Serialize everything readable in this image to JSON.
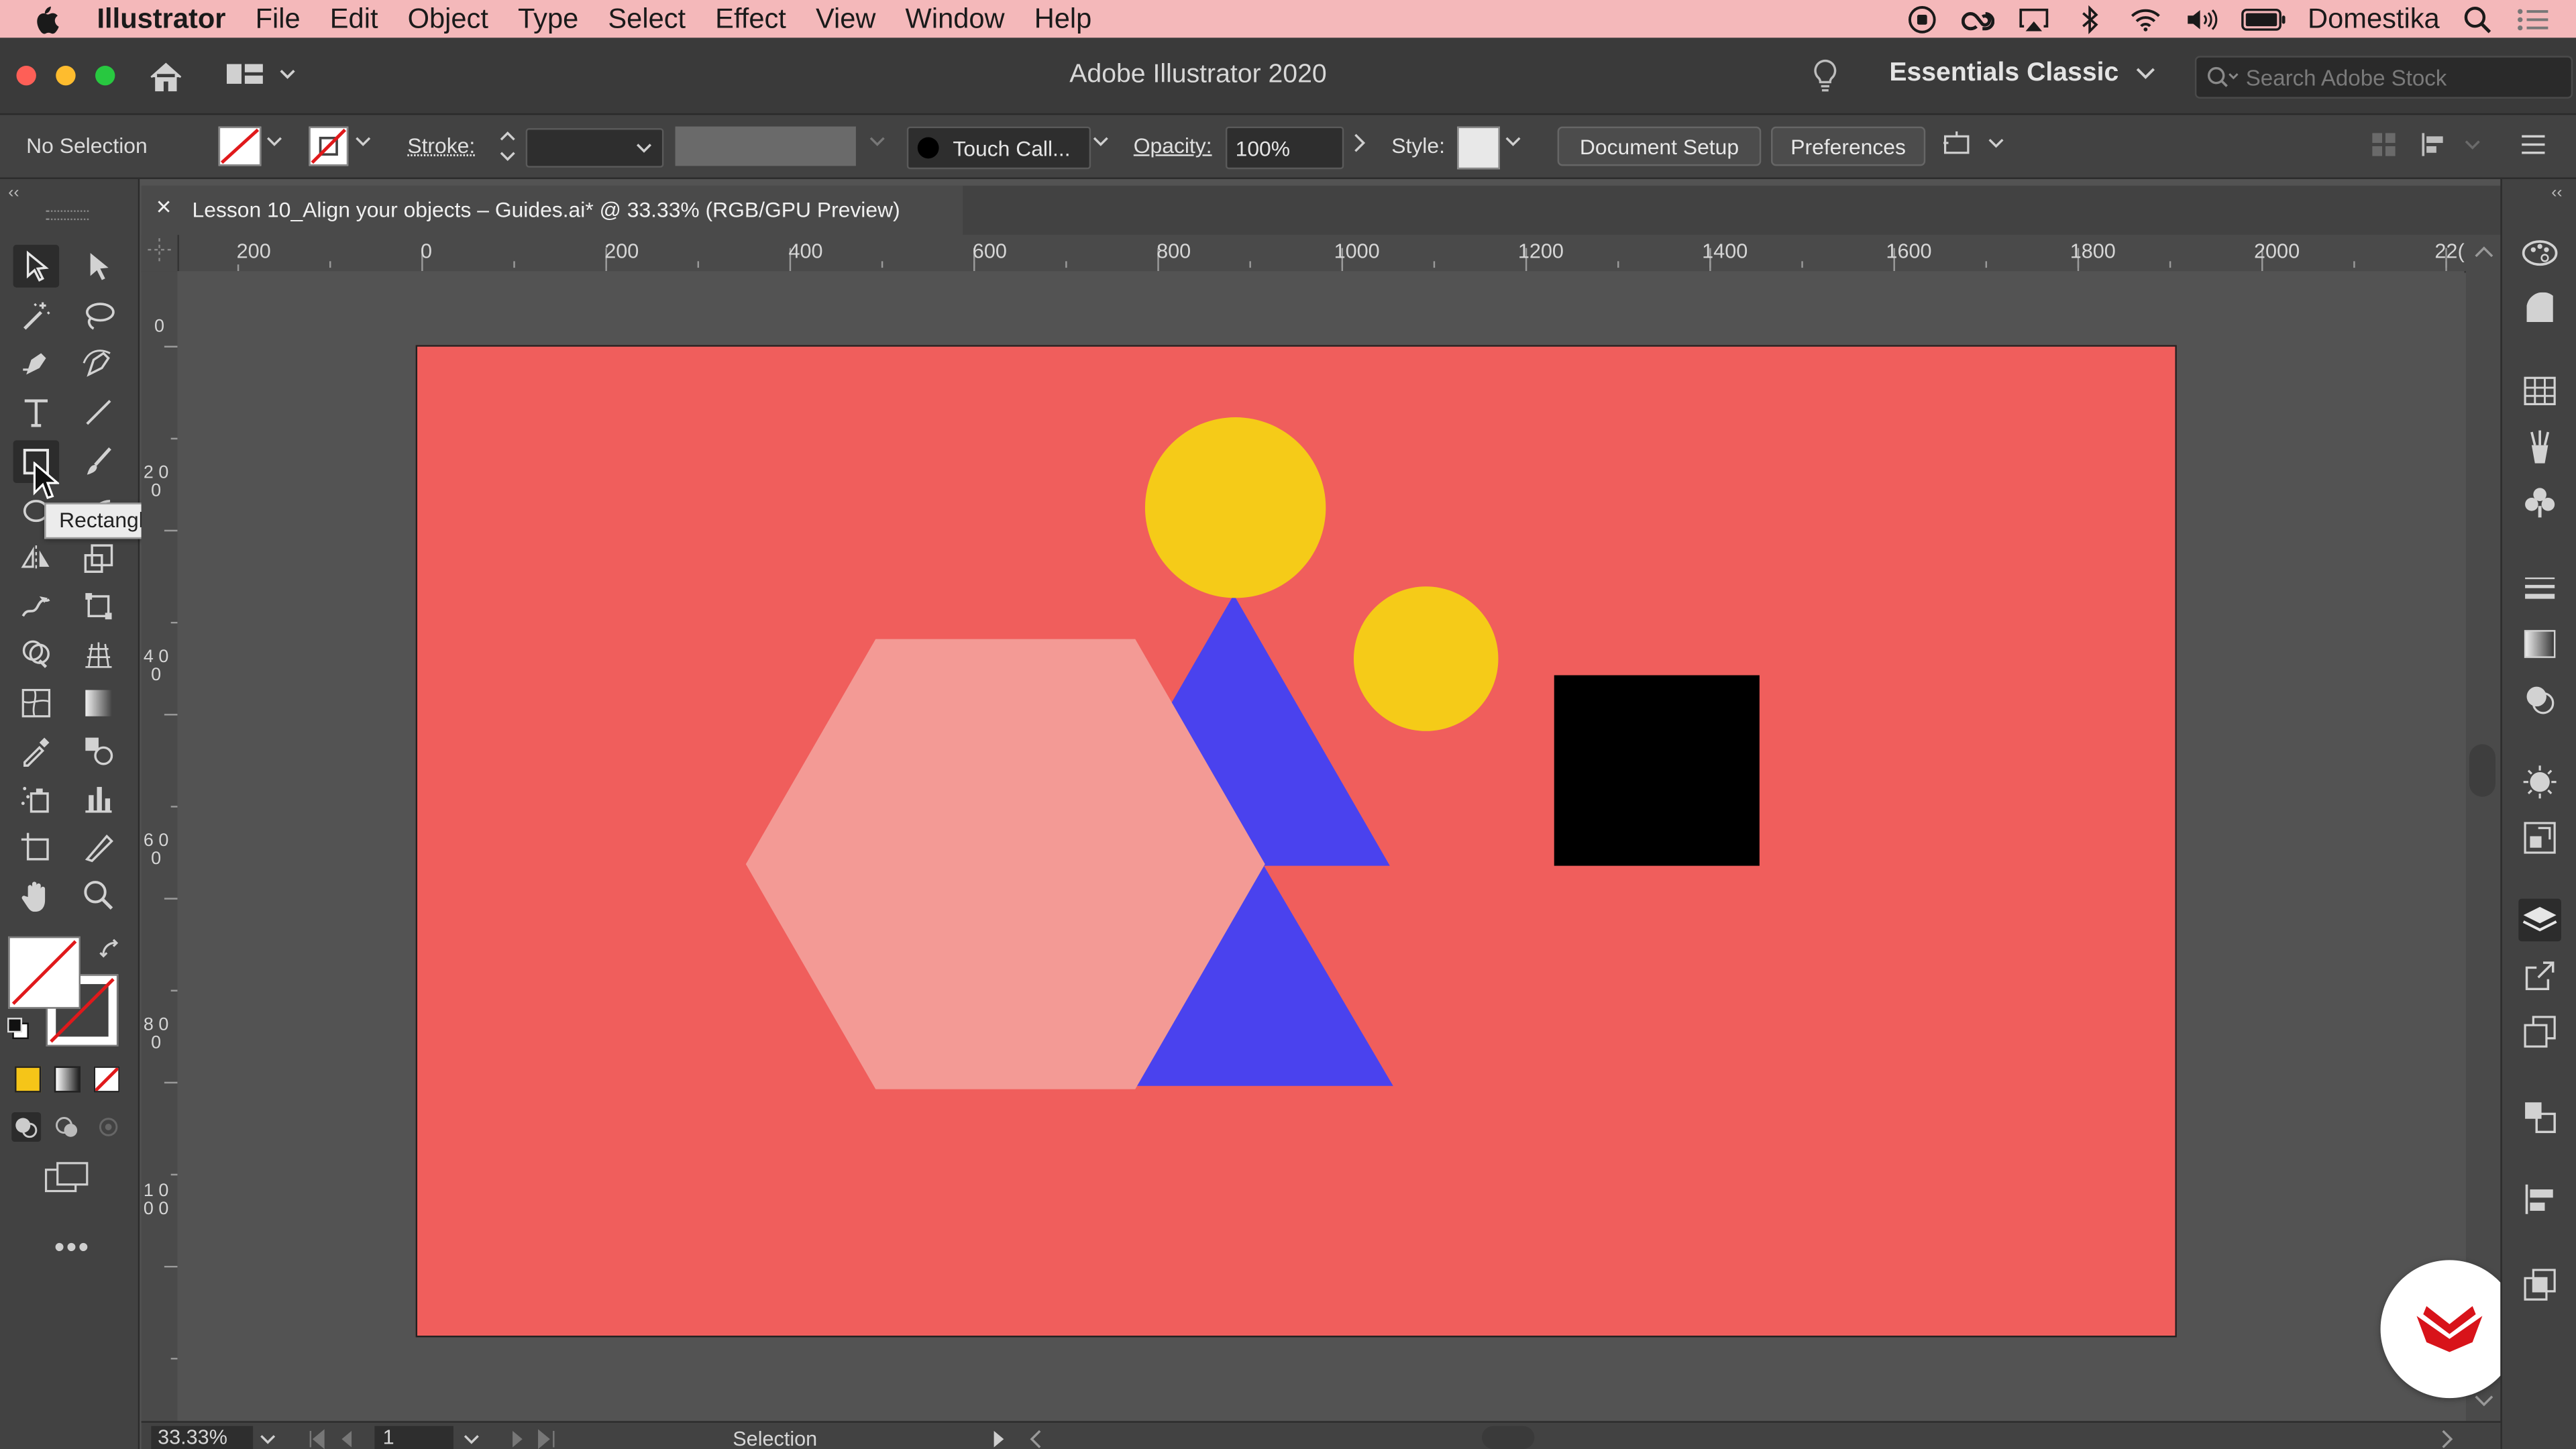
{
  "menubar": {
    "app_name": "Illustrator",
    "items": [
      "File",
      "Edit",
      "Object",
      "Type",
      "Select",
      "Effect",
      "View",
      "Window",
      "Help"
    ],
    "user": "Domestika"
  },
  "appbar": {
    "title": "Adobe Illustrator 2020",
    "workspace": "Essentials Classic",
    "search_placeholder": "Search Adobe Stock"
  },
  "control_bar": {
    "selection_status": "No Selection",
    "stroke_label": "Stroke:",
    "brush_name": "Touch Call...",
    "opacity_label": "Opacity:",
    "opacity_value": "100%",
    "style_label": "Style:",
    "document_setup": "Document Setup",
    "preferences": "Preferences"
  },
  "document": {
    "tab_title": "Lesson 10_Align your objects – Guides.ai* @ 33.33% (RGB/GPU Preview)",
    "close_glyph": "×"
  },
  "rulers": {
    "horizontal": [
      "200",
      "0",
      "200",
      "400",
      "600",
      "800",
      "1000",
      "1200",
      "1400",
      "1600",
      "1800",
      "2000",
      "22("
    ],
    "vertical": [
      "0",
      "2 0 0",
      "4 0 0",
      "6 0 0",
      "8 0 0",
      "1 0 0 0"
    ]
  },
  "tooltip": "Rectangle Tool (M)",
  "status_bar": {
    "zoom": "33.33%",
    "artboard_number": "1",
    "tool_status": "Selection"
  },
  "colors": {
    "artboard": "#f05e5c",
    "yellow": "#f5cb18",
    "blue": "#4a42ee",
    "hexagon": "#f39a95",
    "square": "#000000",
    "menubar": "#f4b8ba",
    "domestika_red": "#d8131a"
  },
  "icons": {
    "tools": [
      "selection-tool-icon",
      "direct-selection-tool-icon",
      "magic-wand-tool-icon",
      "lasso-tool-icon",
      "pen-tool-icon",
      "curvature-tool-icon",
      "type-tool-icon",
      "line-segment-tool-icon",
      "rectangle-tool-icon",
      "paintbrush-tool-icon",
      "ellipse-tool-icon",
      "shaper-tool-icon",
      "reflect-tool-icon",
      "scale-tool-icon",
      "warp-tool-icon",
      "free-transform-tool-icon",
      "shape-builder-tool-icon",
      "perspective-grid-tool-icon",
      "mesh-tool-icon",
      "gradient-tool-icon",
      "eyedropper-tool-icon",
      "blend-tool-icon",
      "symbol-sprayer-tool-icon",
      "column-graph-tool-icon",
      "artboard-tool-icon",
      "slice-tool-icon",
      "hand-tool-icon",
      "zoom-tool-icon"
    ],
    "panels": [
      "color-guide-icon",
      "color-icon",
      "swatches-icon",
      "brushes-icon",
      "symbols-icon",
      "stroke-icon",
      "gradient-icon",
      "transparency-icon",
      "appearance-icon",
      "graphic-styles-icon",
      "layers-icon",
      "asset-export-icon",
      "artboards-icon",
      "transform-icon",
      "align-icon",
      "pathfinder-icon"
    ]
  }
}
